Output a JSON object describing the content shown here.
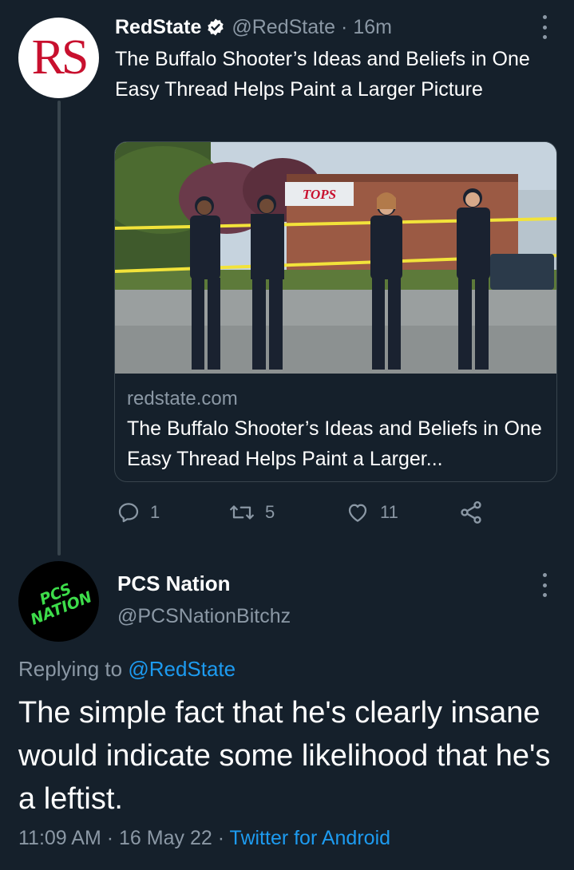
{
  "colors": {
    "background": "#15202b",
    "text_primary": "#ffffff",
    "text_secondary": "#8b98a5",
    "accent": "#1d9bf0",
    "border": "#38444d"
  },
  "parent_tweet": {
    "avatar_text": "RS",
    "author_name": "RedState",
    "verified_icon": "verified-badge-icon",
    "handle": "@RedState",
    "separator": "·",
    "time": "16m",
    "text": "The Buffalo Shooter’s Ideas and Beliefs in One Easy Thread Helps Paint a Larger Picture",
    "card": {
      "domain": "redstate.com",
      "title": "The Buffalo Shooter’s Ideas and Beliefs in One Easy Thread Helps Paint a Larger...",
      "image_sign": "TOPS"
    },
    "actions": {
      "reply_count": "1",
      "retweet_count": "5",
      "like_count": "11"
    }
  },
  "reply_tweet": {
    "avatar_text_line1": "PCS",
    "avatar_text_line2": "NATION",
    "author_name": "PCS Nation",
    "handle": "@PCSNationBitchz",
    "replying_prefix": "Replying to",
    "replying_handle": "@RedState",
    "text": "The simple fact that he's clearly insane would indicate some likelihood that he's a leftist.",
    "time": "11:09 AM",
    "date": "16 May 22",
    "separator": "·",
    "source": "Twitter for Android"
  }
}
